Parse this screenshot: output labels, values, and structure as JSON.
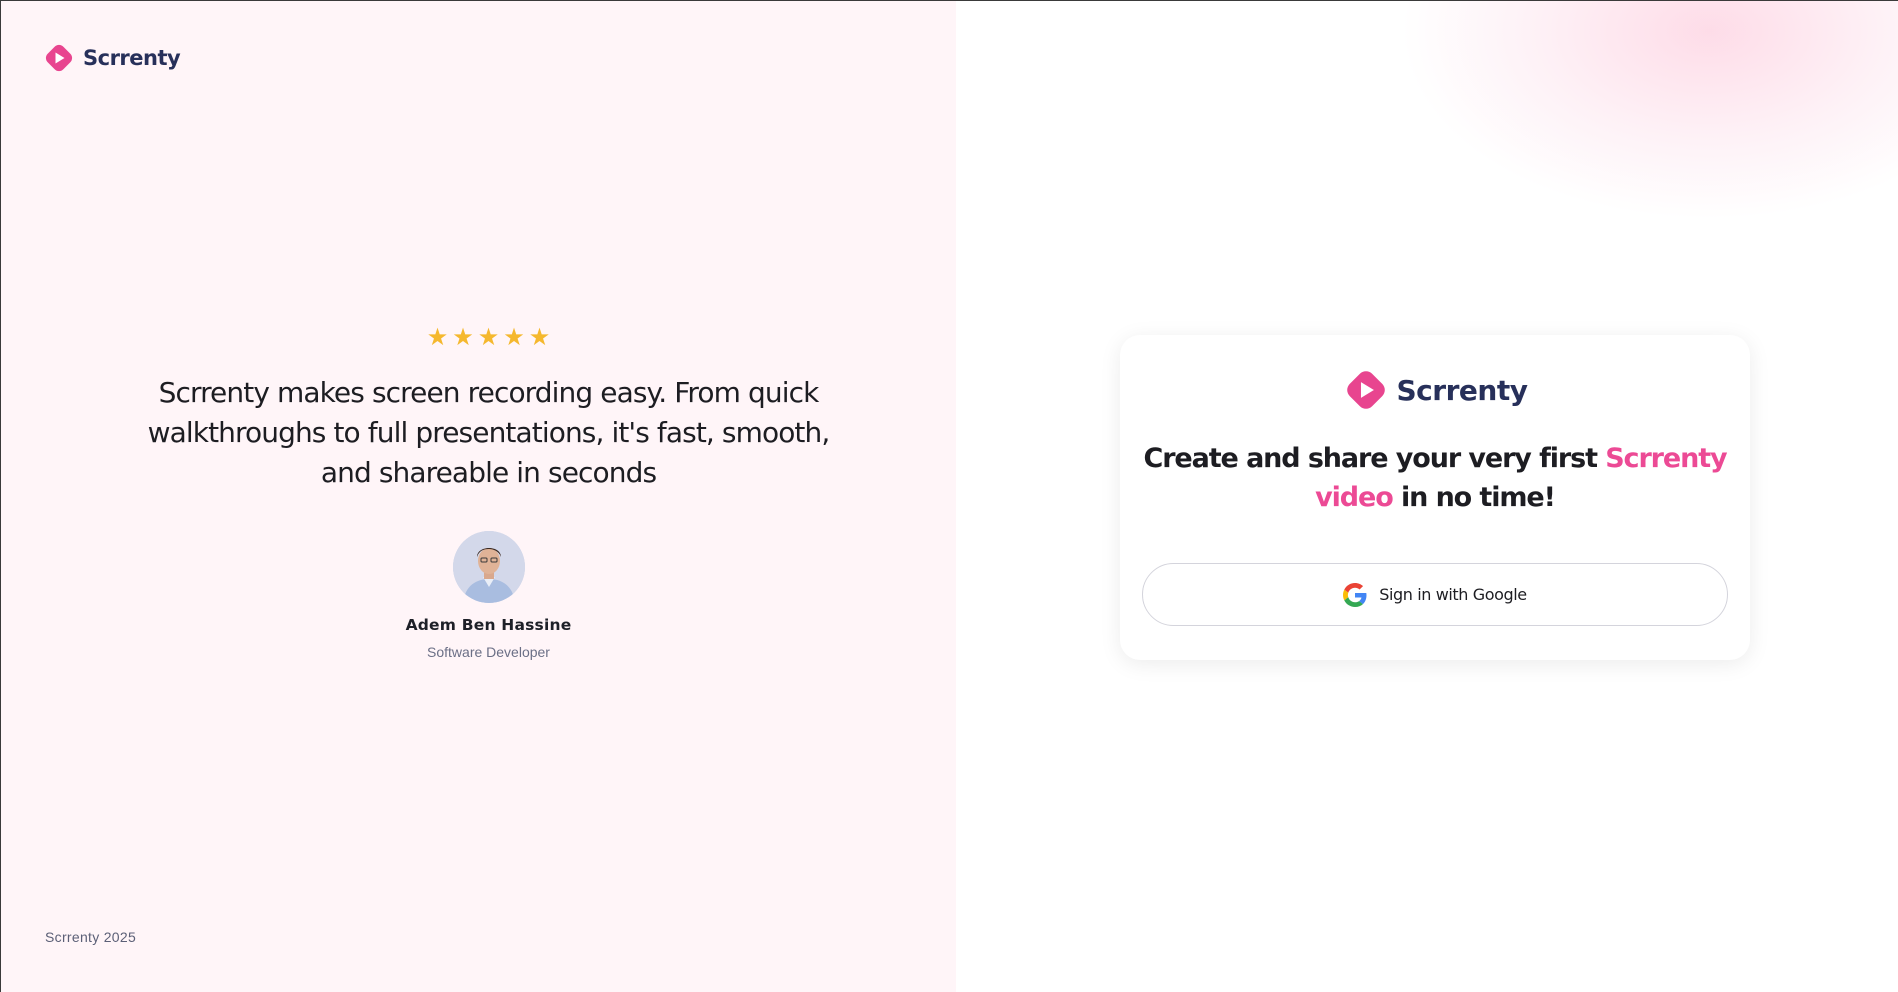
{
  "brand": {
    "name": "Scrrenty",
    "colors": {
      "primary": "#e8458f",
      "primary_dark": "#c7337a",
      "text": "#27305a",
      "accent_text": "#ec4a95"
    }
  },
  "left": {
    "rating": [
      "star-icon",
      "star-icon",
      "star-icon",
      "star-icon",
      "star-icon"
    ],
    "rating_glyph": "★",
    "quote": "Scrrenty makes screen recording easy. From quick walkthroughs to full presentations, it's fast, smooth, and shareable in seconds",
    "author": {
      "name": "Adem Ben Hassine",
      "role": "Software Developer"
    },
    "footer": "Scrrenty 2025"
  },
  "card": {
    "title_part1": "Create and share your very first ",
    "title_accent": "Scrrenty video",
    "title_part2": " in no time!",
    "google_button": "Sign in with Google",
    "google_icon": "google-icon"
  }
}
